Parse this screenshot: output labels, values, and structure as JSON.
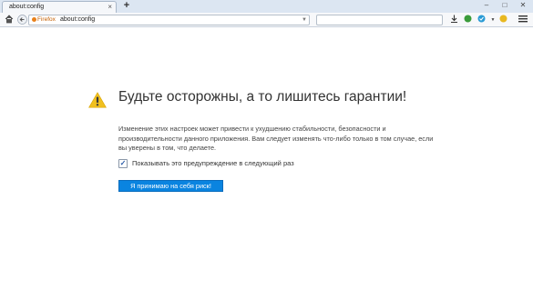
{
  "tab": {
    "title": "about:config",
    "close_glyph": "×",
    "new_tab_glyph": "+"
  },
  "window_controls": {
    "minimize": "–",
    "maximize": "□",
    "close": "✕"
  },
  "navbar": {
    "home_icon": "home-icon",
    "back_icon": "back-arrow-icon",
    "identity_label": "Firefox",
    "url": "about:config",
    "toolbar_icons": [
      "download-icon",
      "addon-green-icon",
      "addon-blue-icon",
      "addon-yellow-icon",
      "menu-icon"
    ]
  },
  "warning": {
    "title": "Будьте осторожны, а то лишитесь гарантии!",
    "description": "Изменение этих настроек может привести к ухудшению стабильности, безопасности и производительности данного приложения. Вам следует изменять что-либо только в том случае, если вы уверены в том, что делаете.",
    "checkbox_label": "Показывать это предупреждение в следующий раз",
    "checkbox_checked": true,
    "check_glyph": "✓",
    "accept_button": "Я принимаю на себя риск!"
  },
  "colors": {
    "accent": "#0a84e0",
    "warning_icon": "#f0c020",
    "tabstrip": "#dce6f2"
  }
}
